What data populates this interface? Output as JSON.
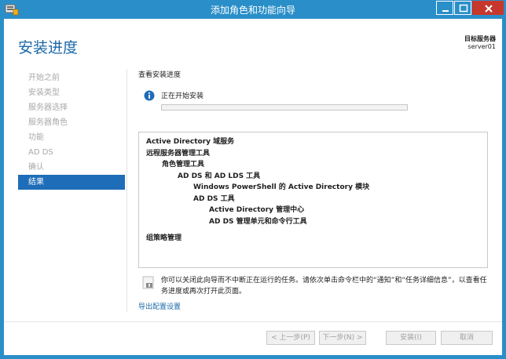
{
  "window": {
    "title": "添加角色和功能向导"
  },
  "header": {
    "page_title": "安装进度",
    "target_label": "目标服务器",
    "target_value": "server01"
  },
  "nav": {
    "items": [
      {
        "label": "开始之前"
      },
      {
        "label": "安装类型"
      },
      {
        "label": "服务器选择"
      },
      {
        "label": "服务器角色"
      },
      {
        "label": "功能"
      },
      {
        "label": "AD DS"
      },
      {
        "label": "确认"
      },
      {
        "label": "结果"
      }
    ]
  },
  "main": {
    "section_label": "查看安装进度",
    "status_text": "正在开始安装",
    "progress": 0,
    "results": [
      {
        "label": "Active Directory 域服务"
      },
      {
        "label": "远程服务器管理工具"
      },
      {
        "label": "角色管理工具"
      },
      {
        "label": "AD DS 和 AD LDS 工具"
      },
      {
        "label": "Windows PowerShell 的 Active Directory 模块"
      },
      {
        "label": "AD DS 工具"
      },
      {
        "label": "Active Directory 管理中心"
      },
      {
        "label": "AD DS 管理单元和命令行工具"
      },
      {
        "label": "组策略管理"
      }
    ],
    "note_text": "你可以关闭此向导而不中断正在运行的任务。请依次单击命令栏中的“通知”和“任务详细信息”，以查看任务进度或再次打开此页面。",
    "export_link": "导出配置设置"
  },
  "footer": {
    "prev": "< 上一步(P)",
    "next": "下一步(N) >",
    "install": "安装(I)",
    "cancel": "取消"
  },
  "colors": {
    "accent": "#2a8fc9",
    "title_blue": "#1a68a8",
    "selected_nav": "#1e6db8"
  }
}
